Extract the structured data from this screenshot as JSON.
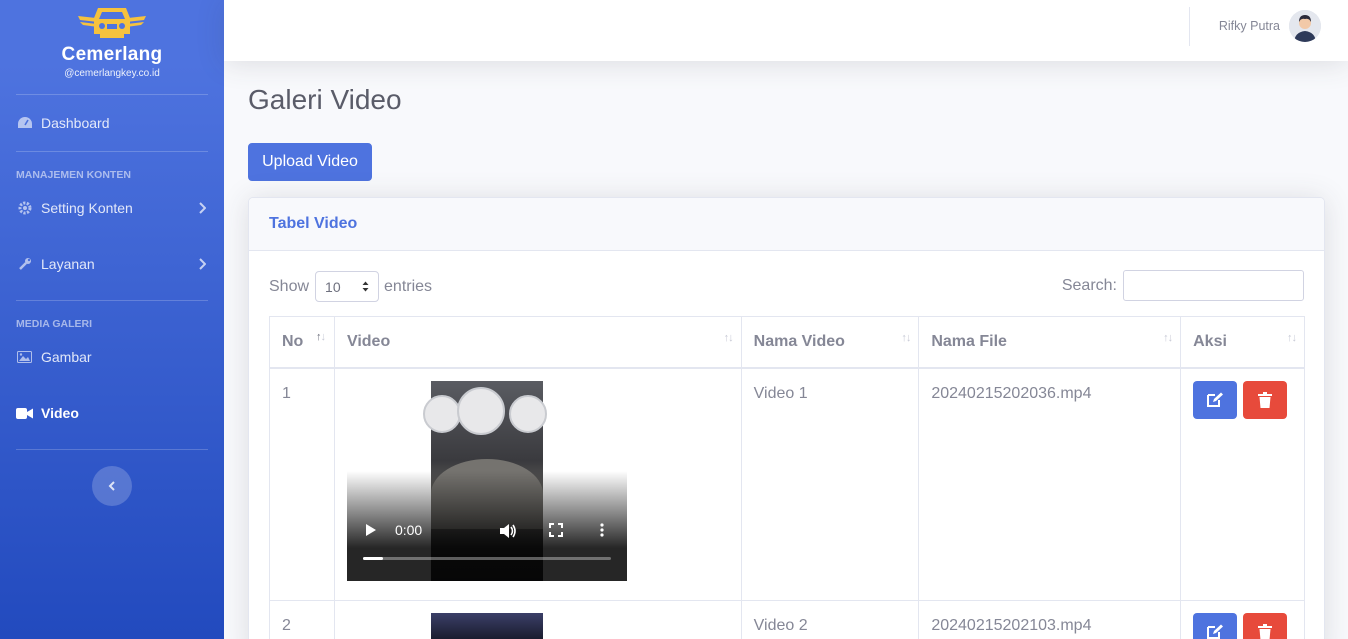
{
  "brand": {
    "name": "Cemerlang",
    "email": "@cemerlangkey.co.id"
  },
  "sidebar": {
    "items": [
      {
        "label": "Dashboard",
        "icon": "dashboard-icon"
      },
      {
        "heading": "MANAJEMEN KONTEN"
      },
      {
        "label": "Setting Konten",
        "icon": "gear-icon"
      },
      {
        "label": "Layanan",
        "icon": "wrench-icon"
      },
      {
        "heading": "MEDIA GALERI"
      },
      {
        "label": "Gambar",
        "icon": "image-icon"
      },
      {
        "label": "Video",
        "icon": "video-icon",
        "active": true
      }
    ]
  },
  "topbar": {
    "user_name": "Rifky Putra"
  },
  "page": {
    "title": "Galeri Video",
    "upload_button": "Upload Video"
  },
  "card": {
    "title": "Tabel Video",
    "show_label": "Show",
    "entries_value": "10",
    "entries_label": "entries",
    "search_label": "Search:"
  },
  "table": {
    "columns": [
      "No",
      "Video",
      "Nama Video",
      "Nama File",
      "Aksi"
    ],
    "rows": [
      {
        "no": "1",
        "nama_video": "Video 1",
        "nama_file": "20240215202036.mp4",
        "video_time": "0:00"
      },
      {
        "no": "2",
        "nama_video": "Video 2",
        "nama_file": "20240215202103.mp4"
      }
    ]
  },
  "colors": {
    "primary": "#4e73df",
    "danger": "#e74a3b",
    "text": "#858796"
  }
}
